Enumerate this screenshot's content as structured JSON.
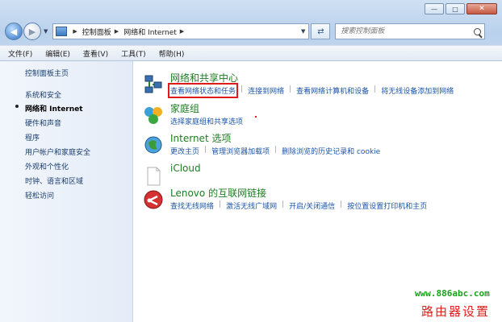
{
  "window": {
    "minimize": "—",
    "maximize": "□",
    "close": "✕"
  },
  "nav": {
    "back_icon": "back-arrow-icon",
    "forward_icon": "forward-arrow-icon",
    "breadcrumb": [
      "控制面板",
      "网络和 Internet"
    ],
    "refresh_icon": "refresh-icon",
    "search_placeholder": "搜索控制面板"
  },
  "menubar": [
    "文件(F)",
    "编辑(E)",
    "查看(V)",
    "工具(T)",
    "帮助(H)"
  ],
  "sidebar": {
    "items": [
      {
        "label": "控制面板主页",
        "active": false
      },
      {
        "label": "系统和安全",
        "active": false
      },
      {
        "label": "网络和 Internet",
        "active": true
      },
      {
        "label": "硬件和声音",
        "active": false
      },
      {
        "label": "程序",
        "active": false
      },
      {
        "label": "用户帐户和家庭安全",
        "active": false
      },
      {
        "label": "外观和个性化",
        "active": false
      },
      {
        "label": "时钟、语言和区域",
        "active": false
      },
      {
        "label": "轻松访问",
        "active": false
      }
    ]
  },
  "categories": [
    {
      "title": "网络和共享中心",
      "icon": "network-sharing-icon",
      "links": [
        "查看网络状态和任务",
        "连接到网络",
        "查看网络计算机和设备",
        "将无线设备添加到网络"
      ]
    },
    {
      "title": "家庭组",
      "icon": "homegroup-icon",
      "links": [
        "选择家庭组和共享选项"
      ]
    },
    {
      "title": "Internet 选项",
      "icon": "internet-options-icon",
      "links": [
        "更改主页",
        "管理浏览器加载项",
        "删除浏览的历史记录和 cookie"
      ]
    },
    {
      "title": "iCloud",
      "icon": "icloud-icon",
      "links": []
    },
    {
      "title": "Lenovo 的互联网链接",
      "icon": "lenovo-link-icon",
      "links": [
        "查找无线网络",
        "激活无线广域网",
        "开启/关闭通信",
        "按位置设置打印机和主页"
      ]
    }
  ],
  "watermark": {
    "url": "www.886abc.com",
    "text": "路由器设置"
  },
  "colors": {
    "link": "#1b55a8",
    "category_title": "#1d7d21",
    "highlight": "#e01a1a"
  }
}
